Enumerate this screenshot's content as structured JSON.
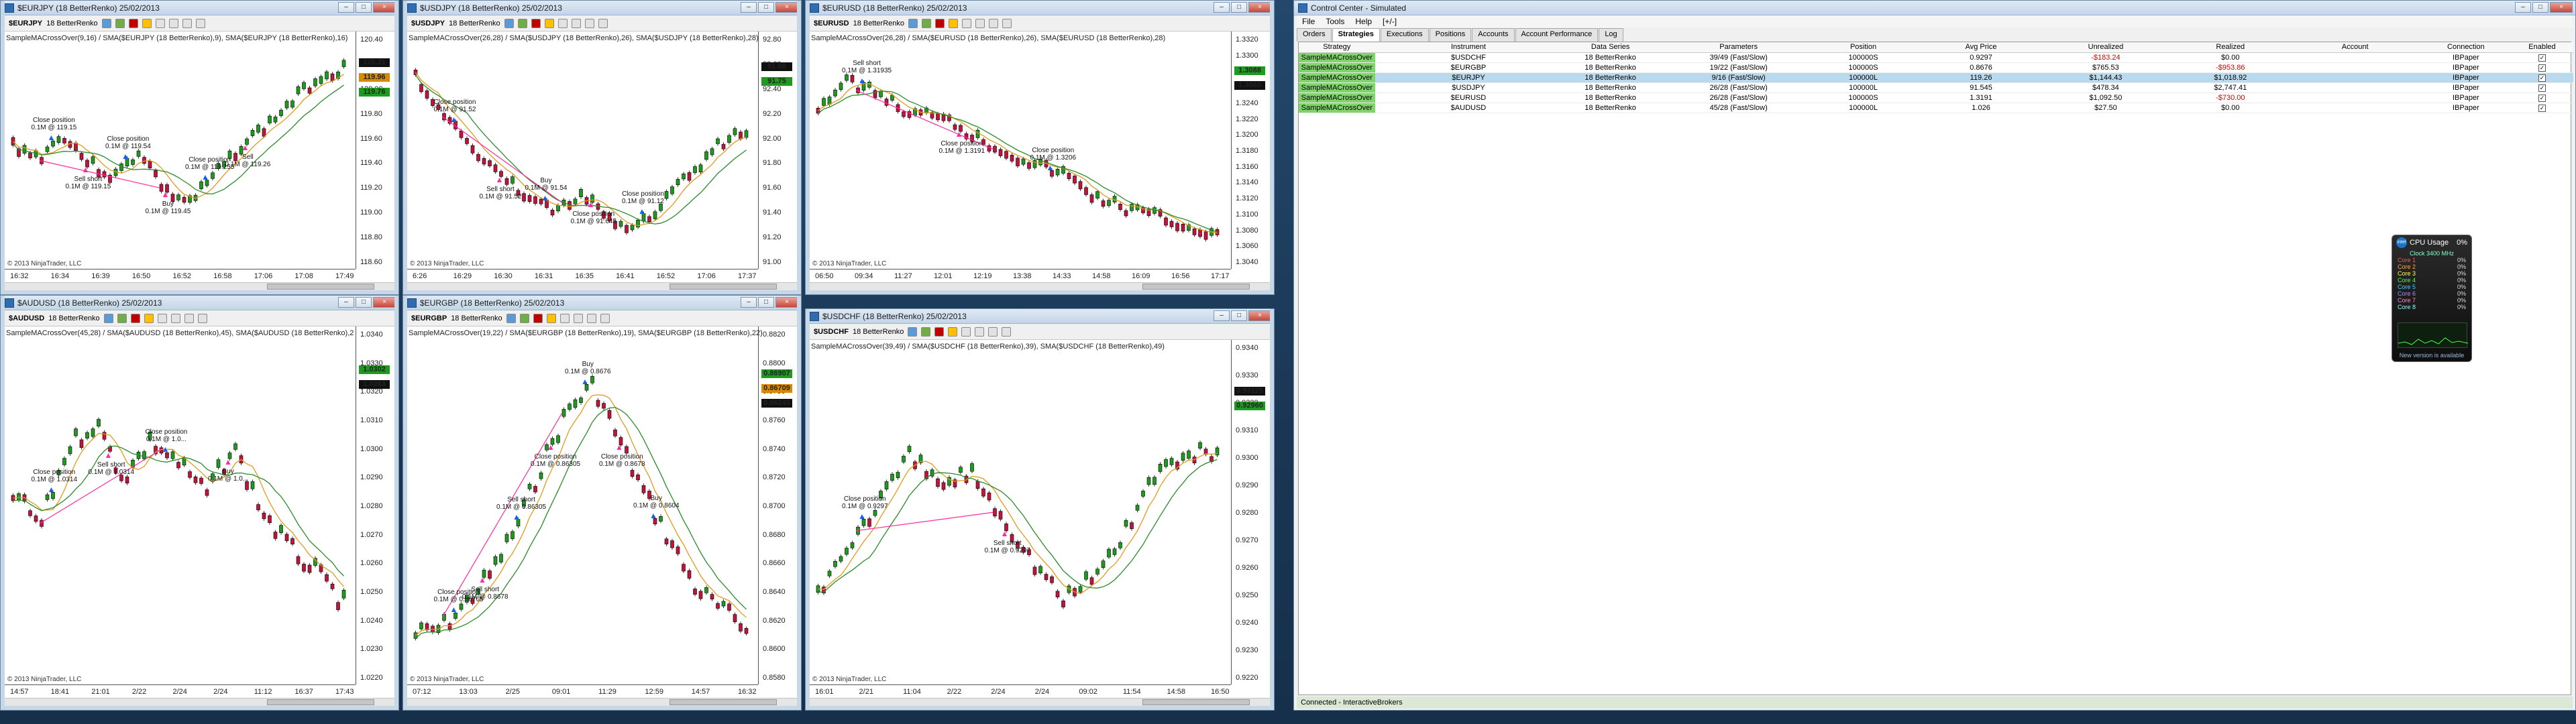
{
  "colors": {
    "up": "#1e9b1e",
    "down": "#c0143c",
    "ma_fast": "#e09b1c",
    "ma_slow": "#2b8a2b",
    "trade_line": "#ff2aa0",
    "buy": "#1060ff"
  },
  "charts": [
    {
      "id": "eurjpy",
      "title": "$EURJPY (18 BetterRenko)  25/02/2013",
      "instrument": "$EURJPY",
      "period": "18 BetterRenko",
      "indicator": "SampleMACrossOver(9,16) / SMA($EURJPY (18 BetterRenko),9), SMA($EURJPY (18 BetterRenko),16)",
      "y_ticks": [
        "120.40",
        "120.20",
        "120.00",
        "119.80",
        "119.60",
        "119.40",
        "119.20",
        "119.00",
        "118.80",
        "118.60"
      ],
      "x_ticks": [
        "16:32",
        "16:34",
        "16:39",
        "16:50",
        "16:52",
        "16:58",
        "17:06",
        "17:08",
        "17:49"
      ],
      "tags": [
        {
          "text": "120.31",
          "cls": "blk"
        },
        {
          "text": "119.96",
          "cls": "org"
        },
        {
          "text": "119.76",
          "cls": "grn"
        }
      ],
      "annotations": [
        "Close position\n0.1M @ 119.15",
        "Sell short\n0.1M @ 119.15",
        "Close position\n0.1M @ 119.54",
        "Buy\n0.1M @ 119.45",
        "Close position\n0.1M @ 119.255",
        "Sell\n0.1M @ 119.26"
      ],
      "copyright": "© 2013 NinjaTrader, LLC"
    },
    {
      "id": "usdjpy",
      "title": "$USDJPY (18 BetterRenko)  25/02/2013",
      "instrument": "$USDJPY",
      "period": "18 BetterRenko",
      "indicator": "SampleMACrossOver(26,28) / SMA($USDJPY (18 BetterRenko),26), SMA($USDJPY (18 BetterRenko),28)",
      "y_ticks": [
        "92.80",
        "92.60",
        "92.40",
        "92.20",
        "92.00",
        "91.80",
        "91.60",
        "91.40",
        "91.20",
        "91.00"
      ],
      "x_ticks": [
        "6:26",
        "16:29",
        "16:30",
        "16:31",
        "16:35",
        "16:41",
        "16:52",
        "17:06",
        "17:37"
      ],
      "tags": [
        {
          "text": "91.88",
          "cls": "blk"
        },
        {
          "text": "91.75",
          "cls": "grn"
        }
      ],
      "annotations": [
        "Close position\n0.1M @ 91.52",
        "Sell short\n0.1M @ 91.52",
        "Buy\n0.1M @ 91.54",
        "Close position\n0.1M @ 91.645",
        "Close position\n0.1M @ 91.12"
      ],
      "copyright": "© 2013 NinjaTrader, LLC"
    },
    {
      "id": "eurusd",
      "title": "$EURUSD (18 BetterRenko)  25/02/2013",
      "instrument": "$EURUSD",
      "period": "18 BetterRenko",
      "indicator": "SampleMACrossOver(26,28) / SMA($EURUSD (18 BetterRenko),26), SMA($EURUSD (18 BetterRenko),28)",
      "y_ticks": [
        "1.3320",
        "1.3300",
        "1.3280",
        "1.3260",
        "1.3240",
        "1.3220",
        "1.3200",
        "1.3180",
        "1.3160",
        "1.3140",
        "1.3120",
        "1.3100",
        "1.3080",
        "1.3060",
        "1.3040"
      ],
      "x_ticks": [
        "06:50",
        "09:34",
        "11:27",
        "12:01",
        "12:19",
        "13:38",
        "14:33",
        "14:58",
        "16:09",
        "16:56",
        "17:17"
      ],
      "tags": [
        {
          "text": "1.3088",
          "cls": "grn"
        },
        {
          "text": "1.3065",
          "cls": "blk"
        }
      ],
      "annotations": [
        "Sell short\n0.1M @ 1.31935",
        "Close position\n0.1M @ 1.3191",
        "Close position\n0.1M @ 1.3206"
      ],
      "copyright": "© 2013 NinjaTrader, LLC"
    },
    {
      "id": "audusd",
      "title": "$AUDUSD (18 BetterRenko)  25/02/2013",
      "instrument": "$AUDUSD",
      "period": "18 BetterRenko",
      "indicator": "SampleMACrossOver(45,28) / SMA($AUDUSD (18 BetterRenko),45), SMA($AUDUSD (18 BetterRenko),2",
      "y_ticks": [
        "1.0340",
        "1.0330",
        "1.0320",
        "1.0310",
        "1.0300",
        "1.0290",
        "1.0280",
        "1.0270",
        "1.0260",
        "1.0250",
        "1.0240",
        "1.0230",
        "1.0220"
      ],
      "x_ticks": [
        "14:57",
        "18:41",
        "21:01",
        "2/22",
        "2/24",
        "2/24",
        "11:12",
        "16:37",
        "17:43"
      ],
      "tags": [
        {
          "text": "1.0302",
          "cls": "grn"
        },
        {
          "text": "1.0263",
          "cls": "blk"
        }
      ],
      "annotations": [
        "Close position\n0.1M @ 1.0314",
        "Sell short\n0.1M @ 1.0314",
        "Close position\n0.1M @ 1.0...",
        "Buy\n0.1M @ 1.0..."
      ],
      "copyright": "© 2013 NinjaTrader, LLC"
    },
    {
      "id": "eurgbp",
      "title": "$EURGBP (18 BetterRenko)  25/02/2013",
      "instrument": "$EURGBP",
      "period": "18 BetterRenko",
      "indicator": "SampleMACrossOver(19,22) / SMA($EURGBP (18 BetterRenko),19), SMA($EURGBP (18 BetterRenko),22)",
      "y_ticks": [
        "0.8820",
        "0.8800",
        "0.8780",
        "0.8760",
        "0.8740",
        "0.8720",
        "0.8700",
        "0.8680",
        "0.8660",
        "0.8640",
        "0.8620",
        "0.8600",
        "0.8580"
      ],
      "x_ticks": [
        "07:12",
        "13:03",
        "2/25",
        "09:01",
        "11:29",
        "12:59",
        "14:57",
        "16:32"
      ],
      "tags": [
        {
          "text": "0.86907",
          "cls": "grn"
        },
        {
          "text": "0.86709",
          "cls": "org"
        },
        {
          "text": "0.86245",
          "cls": "blk"
        }
      ],
      "annotations": [
        "Close position\n0.1M @ 0.86765",
        "Sell short\n0.1M @ 0.8678",
        "Sell short\n0.1M @ 0.86305",
        "Close position\n0.1M @ 0.86305",
        "Buy\n0.1M @ 0.8676",
        "Close position\n0.1M @ 0.8678",
        "Buy\n0.1M @ 0.8604"
      ],
      "copyright": "© 2013 NinjaTrader, LLC"
    },
    {
      "id": "usdchf",
      "title": "$USDCHF (18 BetterRenko)  25/02/2013",
      "instrument": "$USDCHF",
      "period": "18 BetterRenko",
      "indicator": "SampleMACrossOver(39,49) / SMA($USDCHF (18 BetterRenko),39), SMA($USDCHF (18 BetterRenko),49)",
      "y_ticks": [
        "0.9340",
        "0.9330",
        "0.9320",
        "0.9310",
        "0.9300",
        "0.9290",
        "0.9280",
        "0.9270",
        "0.9260",
        "0.9250",
        "0.9240",
        "0.9230",
        "0.9220"
      ],
      "x_ticks": [
        "16:01",
        "2/21",
        "11:04",
        "2/22",
        "2/24",
        "2/24",
        "09:02",
        "11:54",
        "14:58",
        "16:50"
      ],
      "tags": [
        {
          "text": "0.93125",
          "cls": "blk"
        },
        {
          "text": "0.92960",
          "cls": "grn"
        }
      ],
      "annotations": [
        "Close position\n0.1M @ 0.9297",
        "Sell short\n0.1M @ 0.9297"
      ],
      "copyright": "© 2013 NinjaTrader, LLC"
    }
  ],
  "control_center": {
    "title": "Control Center - Simulated",
    "menu": [
      "File",
      "Tools",
      "Help",
      "[+/-]"
    ],
    "tabs": [
      "Orders",
      "Strategies",
      "Executions",
      "Positions",
      "Accounts",
      "Account Performance",
      "Log"
    ],
    "active_tab": "Strategies",
    "columns": [
      "Strategy",
      "Instrument",
      "Data Series",
      "Parameters",
      "Position",
      "Avg Price",
      "Unrealized",
      "Realized",
      "Account",
      "Connection",
      "Enabled"
    ],
    "rows": [
      {
        "strategy": "SampleMACrossOver",
        "instrument": "$USDCHF",
        "series": "18 BetterRenko",
        "params": "39/49 (Fast/Slow)",
        "position": "100000S",
        "avg": "0.9297",
        "unreal": "-$183.24",
        "unreal_neg": true,
        "real": "$0.00",
        "real_neg": false,
        "account": "",
        "conn": "IBPaper",
        "sel": false
      },
      {
        "strategy": "SampleMACrossOver",
        "instrument": "$EURGBP",
        "series": "18 BetterRenko",
        "params": "19/22 (Fast/Slow)",
        "position": "100000S",
        "avg": "0.8676",
        "unreal": "$765.53",
        "unreal_neg": false,
        "real": "-$953.86",
        "real_neg": true,
        "account": "",
        "conn": "IBPaper",
        "sel": false
      },
      {
        "strategy": "SampleMACrossOver",
        "instrument": "$EURJPY",
        "series": "18 BetterRenko",
        "params": "9/16 (Fast/Slow)",
        "position": "100000L",
        "avg": "119.26",
        "unreal": "$1,144.43",
        "unreal_neg": false,
        "real": "$1,018.92",
        "real_neg": false,
        "account": "",
        "conn": "IBPaper",
        "sel": true
      },
      {
        "strategy": "SampleMACrossOver",
        "instrument": "$USDJPY",
        "series": "18 BetterRenko",
        "params": "26/28 (Fast/Slow)",
        "position": "100000L",
        "avg": "91.545",
        "unreal": "$478.34",
        "unreal_neg": false,
        "real": "$2,747.41",
        "real_neg": false,
        "account": "",
        "conn": "IBPaper",
        "sel": false
      },
      {
        "strategy": "SampleMACrossOver",
        "instrument": "$EURUSD",
        "series": "18 BetterRenko",
        "params": "26/28 (Fast/Slow)",
        "position": "100000S",
        "avg": "1.3191",
        "unreal": "$1,092.50",
        "unreal_neg": false,
        "real": "-$730.00",
        "real_neg": true,
        "account": "",
        "conn": "IBPaper",
        "sel": false
      },
      {
        "strategy": "SampleMACrossOver",
        "instrument": "$AUDUSD",
        "series": "18 BetterRenko",
        "params": "45/28 (Fast/Slow)",
        "position": "100000L",
        "avg": "1.026",
        "unreal": "$27.50",
        "unreal_neg": false,
        "real": "$0.00",
        "real_neg": false,
        "account": "",
        "conn": "IBPaper",
        "sel": false
      }
    ],
    "status": "Connected - InteractiveBrokers"
  },
  "cpu_gadget": {
    "title": "CPU Usage",
    "percent": "0%",
    "subtitle": "Clock 3400 MHz",
    "footer": "New version is available",
    "cores": [
      "Core 1",
      "Core 2",
      "Core 3",
      "Core 4",
      "Core 5",
      "Core 6",
      "Core 7",
      "Core 8"
    ]
  }
}
